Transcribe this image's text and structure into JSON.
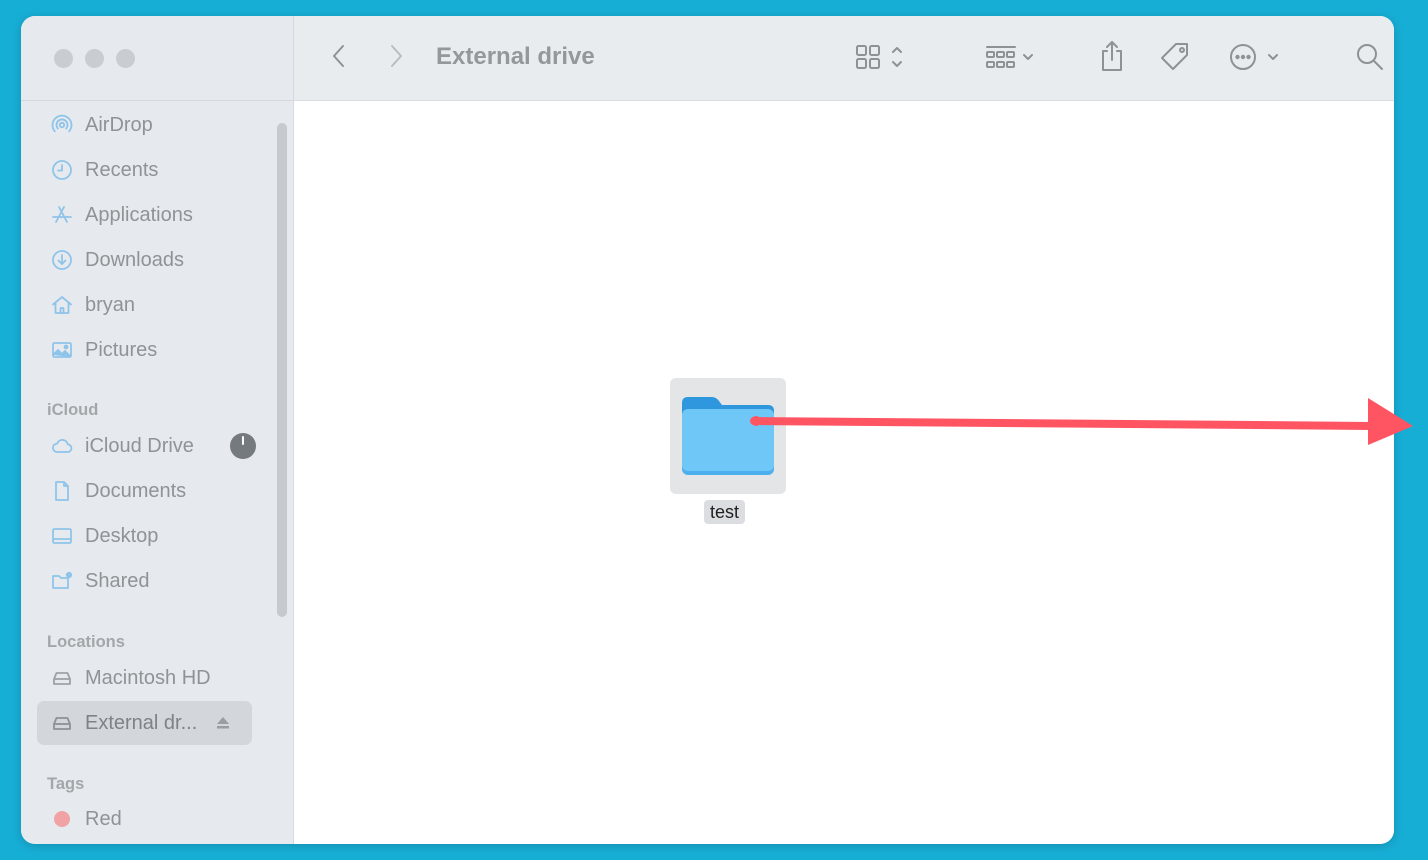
{
  "window": {
    "title": "External drive"
  },
  "sidebar": {
    "favorites": [
      {
        "label": "AirDrop",
        "icon": "airdrop-icon"
      },
      {
        "label": "Recents",
        "icon": "clock-icon"
      },
      {
        "label": "Applications",
        "icon": "applications-icon"
      },
      {
        "label": "Downloads",
        "icon": "download-icon"
      },
      {
        "label": "bryan",
        "icon": "home-icon"
      },
      {
        "label": "Pictures",
        "icon": "photo-icon"
      }
    ],
    "icloud_header": "iCloud",
    "icloud": [
      {
        "label": "iCloud Drive",
        "icon": "cloud-icon"
      },
      {
        "label": "Documents",
        "icon": "document-icon"
      },
      {
        "label": "Desktop",
        "icon": "desktop-icon"
      },
      {
        "label": "Shared",
        "icon": "shared-folder-icon"
      }
    ],
    "locations_header": "Locations",
    "locations": [
      {
        "label": "Macintosh HD",
        "icon": "hard-drive-icon"
      },
      {
        "label": "External dr...",
        "icon": "external-drive-icon",
        "selected": true
      }
    ],
    "tags_header": "Tags",
    "tags": [
      {
        "label": "Red",
        "color": "#f0a2a4"
      }
    ]
  },
  "content": {
    "items": [
      {
        "name": "test",
        "kind": "folder"
      }
    ]
  },
  "annotation": {
    "color": "#ff5563"
  },
  "colors": {
    "desktop": "#17aed6",
    "sidebar": "#e6eaee",
    "folder": "#6ec7f7"
  }
}
